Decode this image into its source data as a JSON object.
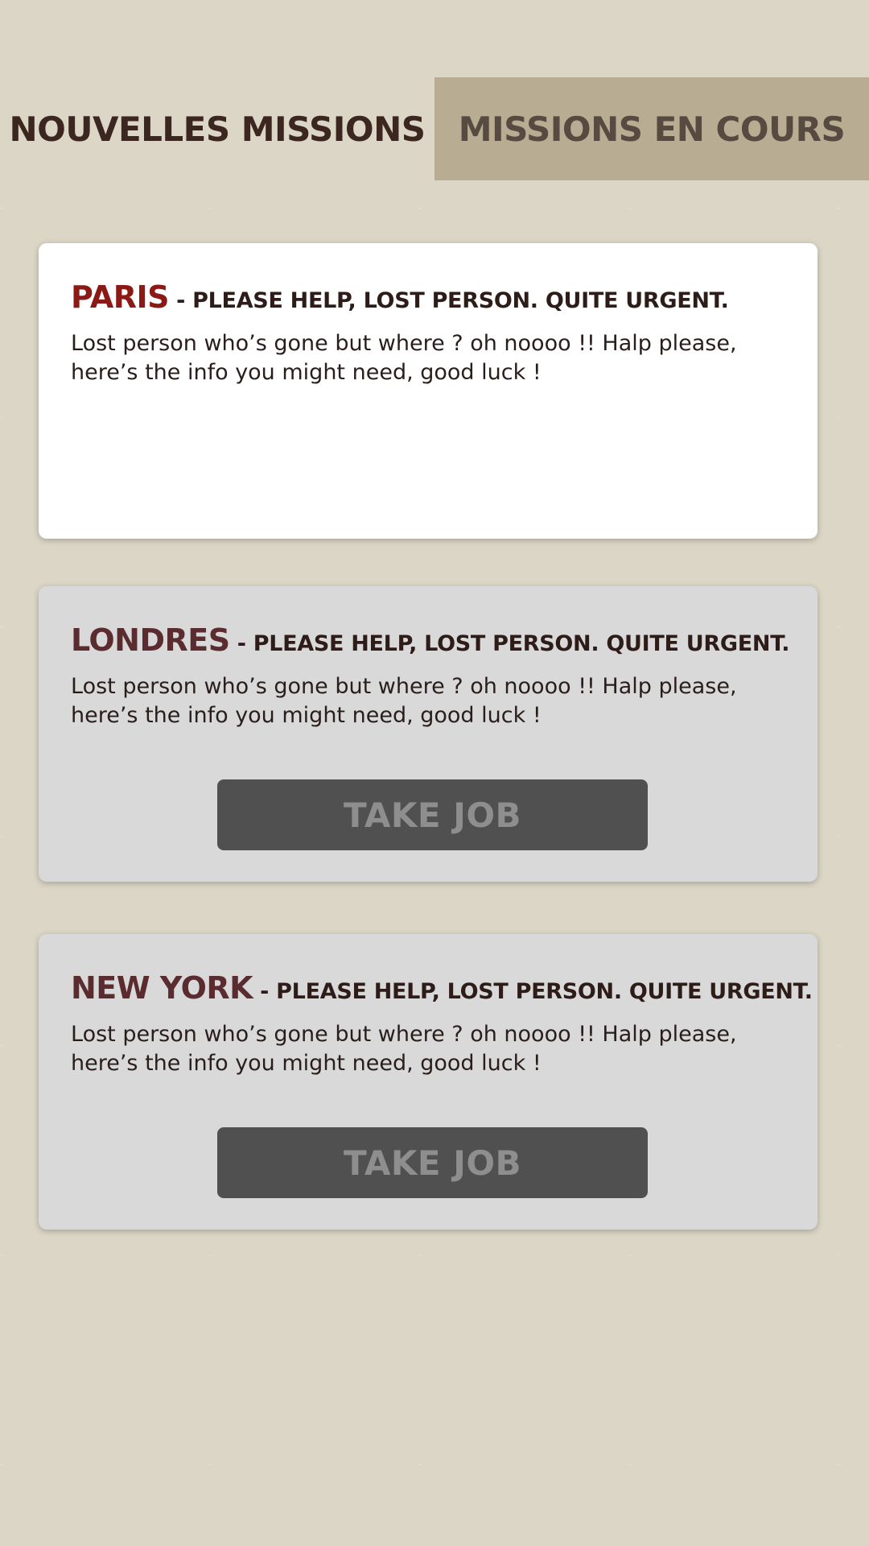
{
  "tabs": {
    "new_label": "NOUVELLES MISSIONS",
    "ongoing_label": "MISSIONS EN COURS"
  },
  "missions": [
    {
      "city": "PARIS",
      "subtitle": " - PLEASE HELP, LOST PERSON. QUITE URGENT.",
      "body": "Lost person who’s gone but where ? oh noooo !! Halp please, here’s the info you might need, good luck !"
    },
    {
      "city": "LONDRES",
      "subtitle": " - PLEASE HELP, LOST PERSON. QUITE URGENT.",
      "body": "Lost person who’s gone but where ? oh noooo !! Halp please, here’s the info you might need, good luck !",
      "button_label": "TAKE JOB"
    },
    {
      "city": "NEW YORK",
      "subtitle": " - PLEASE HELP, LOST PERSON. QUITE URGENT.",
      "body": "Lost person who’s gone but where ? oh noooo !! Halp please, here’s the info you might need, good luck !",
      "button_label": "TAKE JOB"
    }
  ],
  "colors": {
    "background": "#dcd6c6",
    "active_tab": "#b8ad92",
    "selected_card": "#ffffff",
    "card": "#d9d9d9",
    "selected_city": "#8b1a16",
    "city": "#5a2c30",
    "button": "#505050",
    "button_text": "#8e8e8e"
  }
}
